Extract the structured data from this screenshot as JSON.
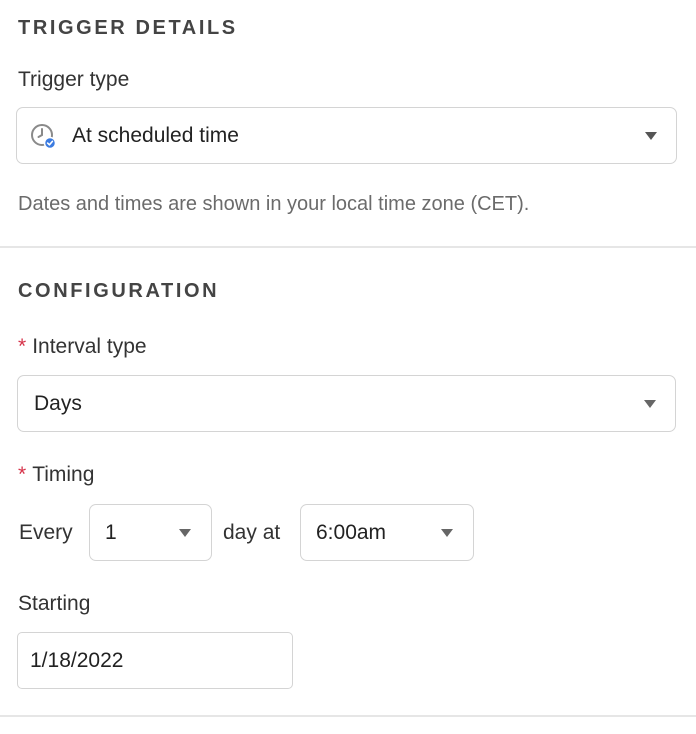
{
  "trigger_details": {
    "section_title": "TRIGGER DETAILS",
    "trigger_type_label": "Trigger type",
    "trigger_type_value": "At scheduled time",
    "trigger_type_icon": "clock-check-icon",
    "timezone_note": "Dates and times are shown in your local time zone (CET)."
  },
  "configuration": {
    "section_title": "CONFIGURATION",
    "required_marker": "*",
    "interval_type_label": "Interval type",
    "interval_type_value": "Days",
    "timing_label": "Timing",
    "every_label": "Every",
    "every_value": "1",
    "day_at_label": "day at",
    "time_value": "6:00am",
    "starting_label": "Starting",
    "starting_value": "1/18/2022"
  },
  "colors": {
    "required": "#d6334a",
    "border": "#d4d4d4",
    "icon_check": "#3b7be0",
    "helper_text": "#6b6b6b"
  }
}
